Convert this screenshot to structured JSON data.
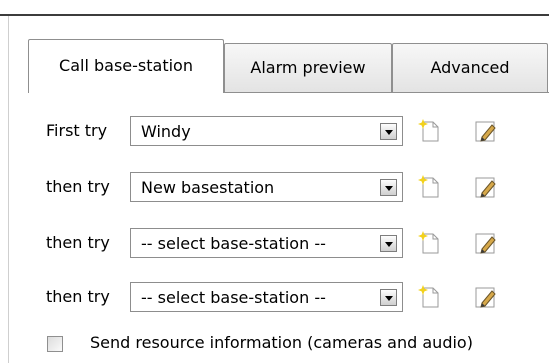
{
  "tabs": [
    {
      "label": "Call base-station",
      "active": true
    },
    {
      "label": "Alarm preview",
      "active": false
    },
    {
      "label": "Advanced",
      "active": false
    }
  ],
  "rows": [
    {
      "label": "First try",
      "value": "Windy"
    },
    {
      "label": "then try",
      "value": "New basestation"
    },
    {
      "label": "then try",
      "value": "-- select base-station --"
    },
    {
      "label": "then try",
      "value": "-- select base-station --"
    }
  ],
  "icons": {
    "new": "new-document-icon",
    "edit": "pencil-edit-icon",
    "dropdown": "chevron-down-icon"
  },
  "checkbox": {
    "label": "Send resource information (cameras and audio)",
    "checked": false
  },
  "colors": {
    "border": "#8f8f8f",
    "star": "#f2d11c",
    "pencil": "#d6a84a"
  }
}
